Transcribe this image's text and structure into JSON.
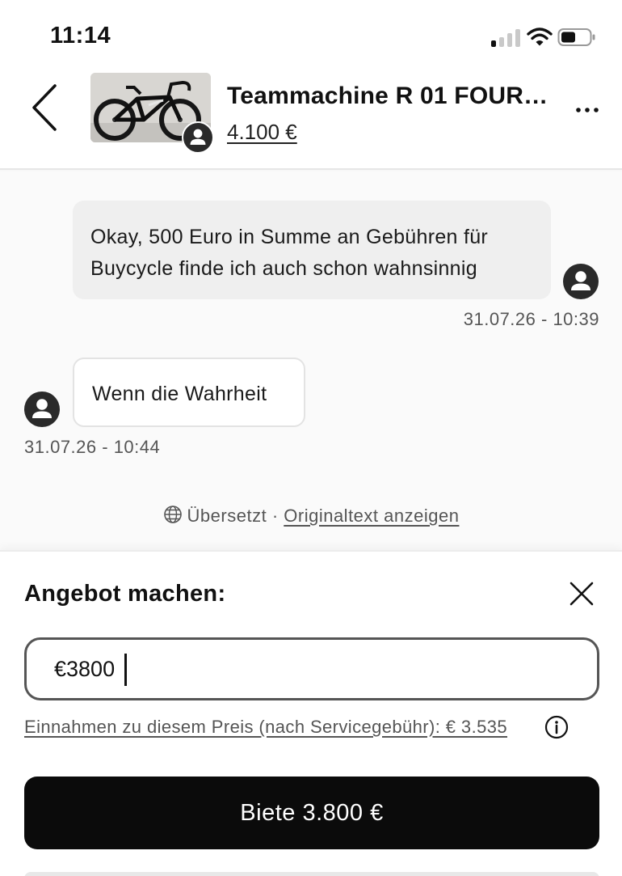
{
  "status_bar": {
    "time": "11:14",
    "icons": [
      "cellular-signal-icon",
      "wifi-icon",
      "battery-icon"
    ]
  },
  "header": {
    "back_icon": "chevron-left-icon",
    "product_title": "Teammachine R 01 FOUR ...",
    "product_price": "4.100 €",
    "more_icon": "ellipsis-icon",
    "seller_avatar_icon": "user-avatar-icon"
  },
  "chat": {
    "messages": [
      {
        "direction": "outgoing",
        "text_line1": "Okay, 500 Euro in Summe an Gebühren für",
        "text_line2": "Buycycle finde ich auch schon wahnsinnig",
        "timestamp": "31.07.26 - 10:39"
      },
      {
        "direction": "incoming",
        "text": "Wenn die Wahrheit",
        "timestamp": "31.07.26 - 10:44"
      }
    ],
    "translation": {
      "icon": "globe-icon",
      "status": "Übersetzt",
      "separator": "·",
      "link": "Originaltext anzeigen"
    }
  },
  "offer_sheet": {
    "title": "Angebot machen:",
    "close_icon": "close-icon",
    "input_value": "€3800",
    "earnings_text": "Einnahmen zu diesem Preis (nach Servicegebühr): € 3.535",
    "info_icon": "info-icon",
    "submit_label": "Biete 3.800 €"
  },
  "colors": {
    "primary_button": "#0b0b0b",
    "outgoing_bubble": "#efefef",
    "incoming_bubble": "#ffffff",
    "muted_text": "#555555"
  }
}
